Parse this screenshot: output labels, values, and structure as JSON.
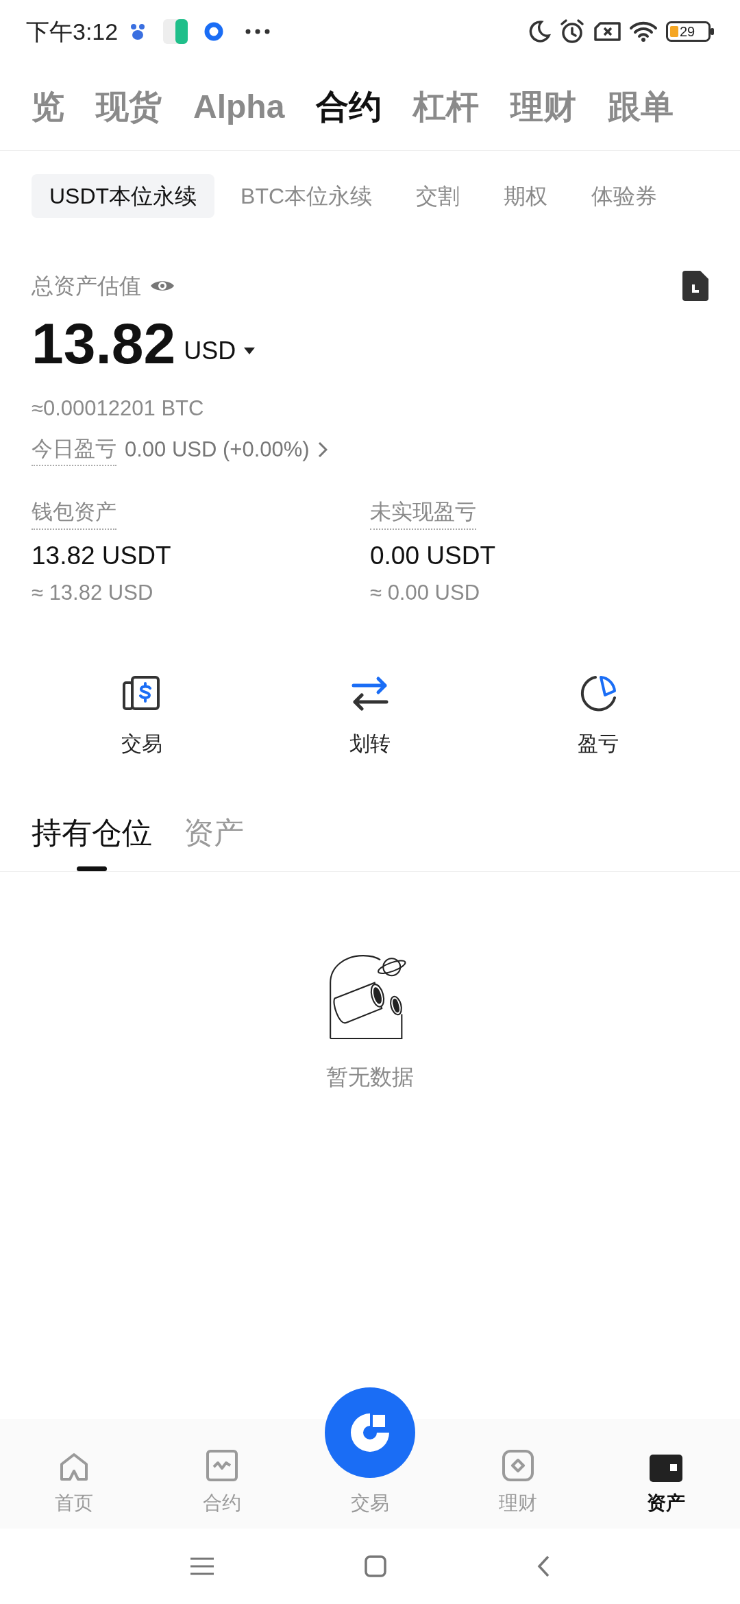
{
  "status_bar": {
    "time": "下午3:12",
    "battery": "29"
  },
  "top_tabs": [
    {
      "label": "览",
      "selected": false
    },
    {
      "label": "现货",
      "selected": false
    },
    {
      "label": "Alpha",
      "selected": false
    },
    {
      "label": "合约",
      "selected": true
    },
    {
      "label": "杠杆",
      "selected": false
    },
    {
      "label": "理财",
      "selected": false
    },
    {
      "label": "跟单",
      "selected": false
    }
  ],
  "sub_tabs": [
    {
      "label": "USDT本位永续",
      "selected": true
    },
    {
      "label": "BTC本位永续",
      "selected": false
    },
    {
      "label": "交割",
      "selected": false
    },
    {
      "label": "期权",
      "selected": false
    },
    {
      "label": "体验券",
      "selected": false
    }
  ],
  "summary": {
    "label": "总资产估值",
    "value": "13.82",
    "currency": "USD",
    "btc_value": "≈0.00012201 BTC",
    "today_pnl_label": "今日盈亏",
    "today_pnl": "0.00 USD (+0.00%)"
  },
  "stats": [
    {
      "label": "钱包资产",
      "value": "13.82 USDT",
      "approx": "≈ 13.82 USD"
    },
    {
      "label": "未实现盈亏",
      "value": "0.00 USDT",
      "approx": "≈ 0.00 USD"
    }
  ],
  "actions": [
    {
      "kind": "trade",
      "label": "交易"
    },
    {
      "kind": "transfer",
      "label": "划转"
    },
    {
      "kind": "pnl",
      "label": "盈亏"
    }
  ],
  "position_tabs": [
    {
      "label": "持有仓位",
      "selected": true
    },
    {
      "label": "资产",
      "selected": false
    }
  ],
  "empty_state": "暂无数据",
  "bottom_nav": [
    {
      "kind": "home",
      "label": "首页",
      "selected": false
    },
    {
      "kind": "futures",
      "label": "合约",
      "selected": false
    },
    {
      "kind": "trade",
      "label": "交易",
      "selected": false
    },
    {
      "kind": "earn",
      "label": "理财",
      "selected": false
    },
    {
      "kind": "assets",
      "label": "资产",
      "selected": true
    }
  ]
}
